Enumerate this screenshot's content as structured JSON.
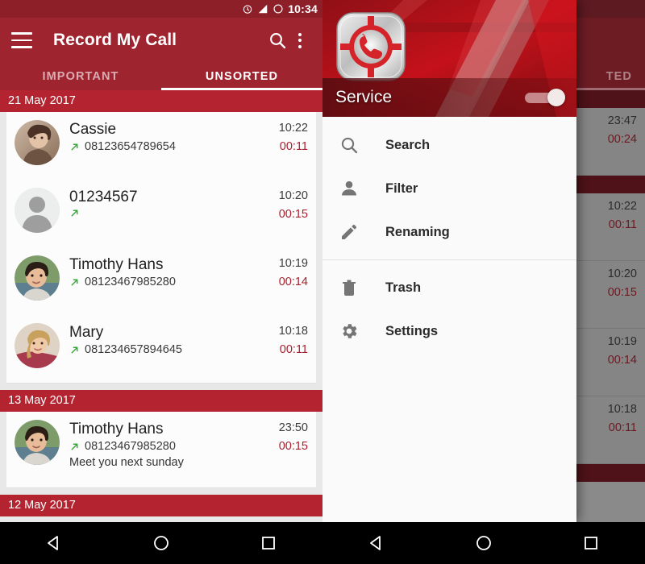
{
  "status_bar": {
    "time": "10:34",
    "icons": [
      "alarm-clock-icon",
      "signal-icon",
      "circle-icon"
    ]
  },
  "app_bar": {
    "title": "Record My Call",
    "menu_icon": "hamburger-icon",
    "search_icon": "search-icon",
    "overflow_icon": "more-vert-icon"
  },
  "tabs": [
    {
      "label": "IMPORTANT",
      "active": false
    },
    {
      "label": "UNSORTED",
      "active": true
    }
  ],
  "colors": {
    "app_bar": "#9e2430",
    "date_header": "#b32430",
    "duration": "#a81f2d",
    "arrow_outgoing": "#2eaa32",
    "drawer_bg": "#fafafa"
  },
  "call_list": [
    {
      "date": "21 May 2017",
      "entries": [
        {
          "name": "Cassie",
          "number": "08123654789654",
          "time": "10:22",
          "duration": "00:11",
          "direction": "outgoing",
          "note": "",
          "avatar": "photo-woman-brown"
        },
        {
          "name": "01234567",
          "number": "",
          "time": "10:20",
          "duration": "00:15",
          "direction": "outgoing",
          "note": "",
          "avatar": "default-person"
        },
        {
          "name": "Timothy Hans",
          "number": "08123467985280",
          "time": "10:19",
          "duration": "00:14",
          "direction": "outgoing",
          "note": "",
          "avatar": "photo-man-dark"
        },
        {
          "name": "Mary",
          "number": "081234657894645",
          "time": "10:18",
          "duration": "00:11",
          "direction": "outgoing",
          "note": "",
          "avatar": "photo-woman-blonde"
        }
      ]
    },
    {
      "date": "13 May 2017",
      "entries": [
        {
          "name": "Timothy Hans",
          "number": "08123467985280",
          "time": "23:50",
          "duration": "00:15",
          "direction": "outgoing",
          "note": "Meet you next sunday",
          "avatar": "photo-man-dark"
        }
      ]
    },
    {
      "date": "12 May 2017",
      "entries": []
    }
  ],
  "drawer": {
    "app_icon": "record-my-call-app-icon",
    "service": {
      "label": "Service",
      "toggle_state": "on"
    },
    "menu_groups": [
      [
        {
          "label": "Search",
          "icon": "search-icon"
        },
        {
          "label": "Filter",
          "icon": "person-icon"
        },
        {
          "label": "Renaming",
          "icon": "pencil-icon"
        }
      ],
      [
        {
          "label": "Trash",
          "icon": "trash-icon"
        },
        {
          "label": "Settings",
          "icon": "gear-icon"
        }
      ]
    ]
  },
  "background_behind_drawer": {
    "tab_label_partial": "TED",
    "rows": [
      {
        "time": "23:47",
        "duration": "00:24"
      },
      {
        "time": "10:22",
        "duration": "00:11"
      },
      {
        "time": "10:20",
        "duration": "00:15"
      },
      {
        "time": "10:19",
        "duration": "00:14"
      },
      {
        "time": "10:18",
        "duration": "00:11"
      }
    ]
  },
  "nav_bar": {
    "back": "back-triangle-icon",
    "home": "home-circle-icon",
    "recents": "recents-square-icon"
  }
}
